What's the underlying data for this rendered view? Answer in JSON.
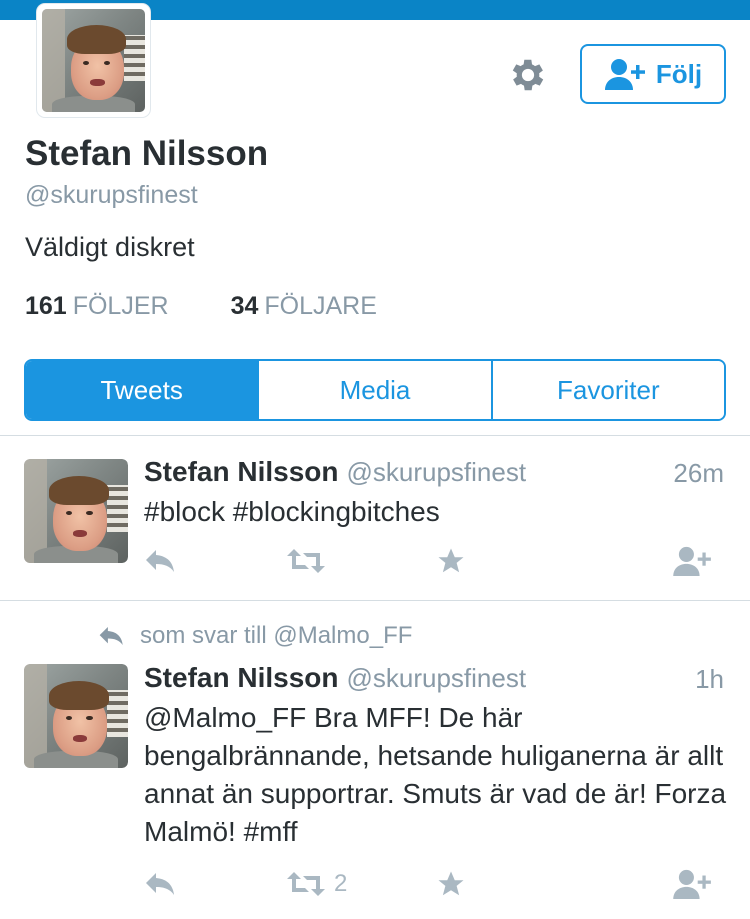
{
  "profile": {
    "name": "Stefan Nilsson",
    "handle": "@skurupsfinest",
    "bio": "Väldigt diskret",
    "following_count": "161",
    "following_label": "FÖLJER",
    "followers_count": "34",
    "followers_label": "FÖLJARE",
    "follow_button_label": "Följ"
  },
  "tabs": [
    {
      "label": "Tweets",
      "active": true
    },
    {
      "label": "Media",
      "active": false
    },
    {
      "label": "Favoriter",
      "active": false
    }
  ],
  "tweets": [
    {
      "name": "Stefan Nilsson",
      "handle": "@skurupsfinest",
      "time": "26m",
      "text": "#block #blockingbitches",
      "retweet_count": ""
    },
    {
      "reply_context": "som svar till @Malmo_FF",
      "name": "Stefan Nilsson",
      "handle": "@skurupsfinest",
      "time": "1h",
      "text": "@Malmo_FF Bra MFF! De här bengalbrännande, hetsande huliganerna är allt annat än supportrar. Smuts är vad de är! Forza Malmö! #mff",
      "retweet_count": "2"
    }
  ],
  "icons": {
    "settings": "gear-icon",
    "follow": "add-user-icon",
    "reply": "reply-icon",
    "retweet": "retweet-icon",
    "favorite": "star-icon",
    "follow_user": "add-user-icon"
  },
  "colors": {
    "accent": "#1b95e0",
    "top_bar": "#0a84c6",
    "muted_text": "#8899a6",
    "action_icons": "#aab8c2"
  }
}
